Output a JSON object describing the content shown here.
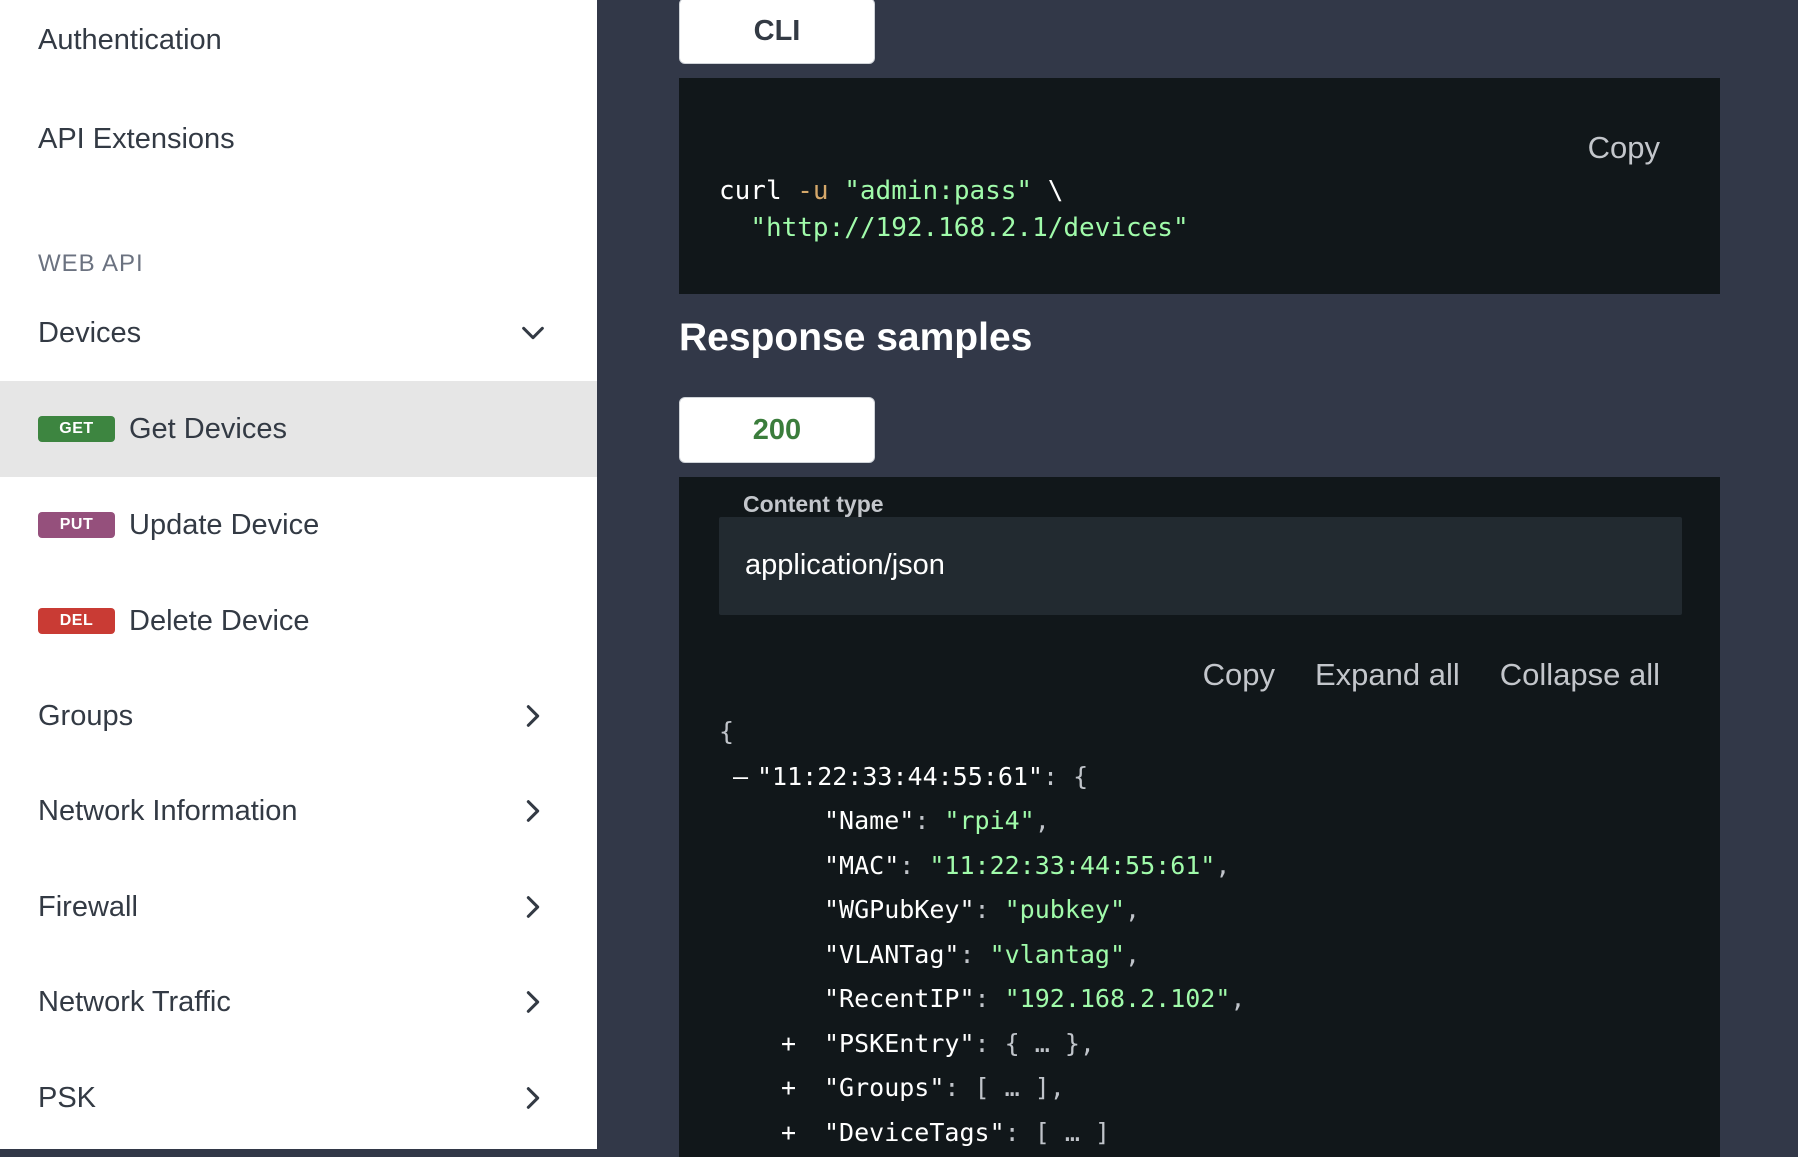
{
  "sidebar": {
    "authentication": "Authentication",
    "api_extensions": "API Extensions",
    "section_web_api": "WEB API",
    "devices": "Devices",
    "get_devices": {
      "method": "GET",
      "label": "Get Devices"
    },
    "update_device": {
      "method": "PUT",
      "label": "Update Device"
    },
    "delete_device": {
      "method": "DEL",
      "label": "Delete Device"
    },
    "groups": "Groups",
    "network_information": "Network Information",
    "firewall": "Firewall",
    "network_traffic": "Network Traffic",
    "psk": "PSK"
  },
  "request": {
    "tab_label": "CLI",
    "copy_label": "Copy",
    "cmd": "curl",
    "flag": "-u",
    "creds": "\"admin:pass\"",
    "cont": "\\",
    "url": "\"http://192.168.2.1/devices\""
  },
  "response": {
    "title": "Response samples",
    "tab_label": "200",
    "content_type_label": "Content type",
    "content_type_value": "application/json",
    "copy_label": "Copy",
    "expand_all_label": "Expand all",
    "collapse_all_label": "Collapse all",
    "json": {
      "open_brace": "{",
      "collapse_toggle": "–",
      "root_key": "\"11:22:33:44:55:61\"",
      "name_key": "\"Name\"",
      "name_value": "\"rpi4\"",
      "mac_key": "\"MAC\"",
      "mac_value": "\"11:22:33:44:55:61\"",
      "wg_key": "\"WGPubKey\"",
      "wg_value": "\"pubkey\"",
      "vlan_key": "\"VLANTag\"",
      "vlan_value": "\"vlantag\"",
      "recentip_key": "\"RecentIP\"",
      "recentip_value": "\"192.168.2.102\"",
      "expand_toggle": "+",
      "pskentry_key": "\"PSKEntry\"",
      "pskentry_collapsed": "{ … }",
      "groups_key": "\"Groups\"",
      "groups_collapsed": "[ … ]",
      "devicetags_key": "\"DeviceTags\"",
      "devicetags_collapsed": "[ … ]"
    }
  },
  "colors": {
    "sidebar_bg": "#ffffff",
    "main_bg": "#323848",
    "code_bg": "#11171a",
    "string": "#a0fbaa",
    "get": "#3d8540",
    "put": "#95507c",
    "del": "#c93b34"
  }
}
